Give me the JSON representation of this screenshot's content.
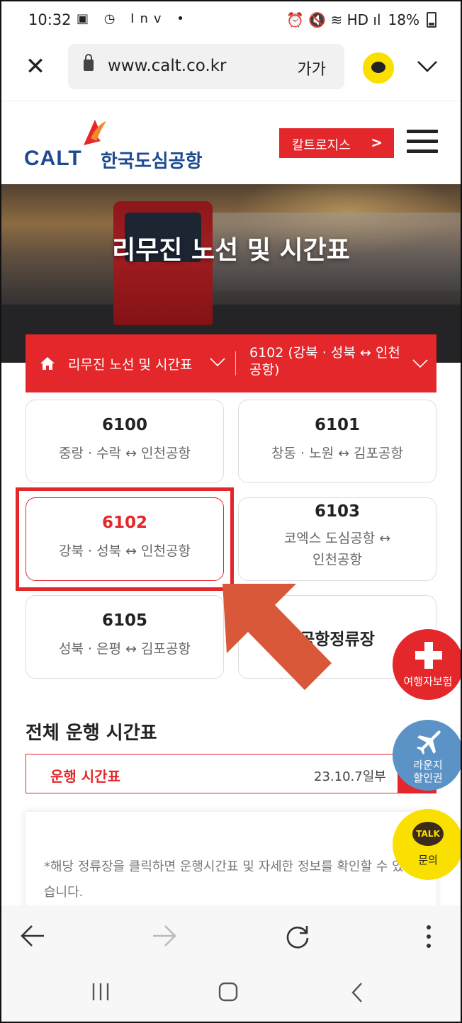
{
  "status_bar": {
    "time": "10:32",
    "left_icons": "▣ ◷ Inv •",
    "right_icons": "⏰ 🔇 ≋ HD ıl",
    "battery": "18%"
  },
  "browser": {
    "url": "www.calt.co.kr",
    "text_size_label": "가가"
  },
  "header": {
    "logo_en": "CALT",
    "logo_ko": "한국도심공항",
    "logistics_button": "칼트로지스",
    "logistics_arrow": ">"
  },
  "hero": {
    "title": "리무진 노선 및 시간표"
  },
  "route_nav": {
    "section": "리무진 노선 및 시간표",
    "current_route": "6102 (강북 · 성북 ↔ 인천공항)"
  },
  "routes": [
    {
      "number": "6100",
      "desc": "중랑 · 수락 ↔ 인천공항"
    },
    {
      "number": "6101",
      "desc": "창동 · 노원 ↔ 김포공항"
    },
    {
      "number": "6102",
      "desc": "강북 · 성북 ↔ 인천공항"
    },
    {
      "number": "6103",
      "desc_line1": "코엑스 도심공항 ↔",
      "desc_line2": "인천공항"
    },
    {
      "number": "6105",
      "desc": "성북 · 은평 ↔ 김포공항"
    },
    {
      "label": "공항정류장"
    }
  ],
  "timetable": {
    "section_title": "전체 운행 시간표",
    "label": "운행 시간표",
    "date": "23.10.7일부"
  },
  "note": {
    "text": "*해당 정류장을 클릭하면 운행시간표 및 자세한 정보를 확인할 수 있습니다."
  },
  "floating": {
    "insurance": "여행자보험",
    "lounge_line1": "라운지",
    "lounge_line2": "할인권",
    "talk_badge": "TALK",
    "talk_label": "문의"
  },
  "colors": {
    "accent_red": "#e4272a",
    "brand_blue": "#1e4b8f",
    "kakao_yellow": "#f9e000",
    "lounge_blue": "#5b93c6",
    "arrow_orange": "#d9583a"
  },
  "icons": [
    "close-icon",
    "lock-icon",
    "kakao-icon",
    "chevron-down-icon",
    "menu-icon",
    "home-icon",
    "back-icon",
    "forward-icon",
    "reload-icon",
    "more-icon",
    "recent-apps-icon",
    "home-button-icon",
    "system-back-icon"
  ]
}
